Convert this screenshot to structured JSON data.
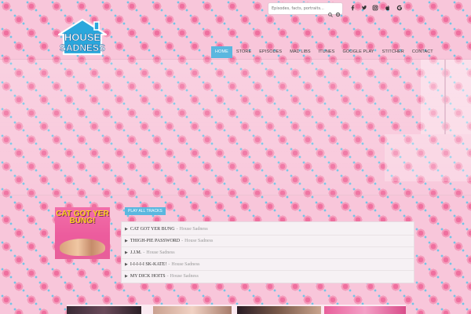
{
  "search": {
    "placeholder": "Episodes, facts, portraits..."
  },
  "social": [
    {
      "icon": "facebook-icon"
    },
    {
      "icon": "twitter-icon"
    },
    {
      "icon": "instagram-icon"
    },
    {
      "icon": "apple-icon"
    },
    {
      "icon": "google-icon"
    }
  ],
  "logo": {
    "line1": "HOUSE",
    "line2": "SADNESS"
  },
  "nav": [
    {
      "label": "HOME",
      "active": true
    },
    {
      "label": "STORE"
    },
    {
      "label": "EPISODES"
    },
    {
      "label": "MAD LIBS"
    },
    {
      "label": "ITUNES"
    },
    {
      "label": "GOOGLE PLAY"
    },
    {
      "label": "STITCHER"
    },
    {
      "label": "CONTACT"
    }
  ],
  "album": {
    "title": "CAT GOT YER BUNG!"
  },
  "player": {
    "play_all_label": "PLAY ALL TRACKS",
    "separator": "-",
    "tracks": [
      {
        "title": "CAT GOT YER BUNG",
        "artist": "House Sadness"
      },
      {
        "title": "THIGH-PIE PASSWORD",
        "artist": "House Sadness"
      },
      {
        "title": "J.J.M.",
        "artist": "House Sadness"
      },
      {
        "title": "I-I-I-I-I SK-KATE!",
        "artist": "House Sadness"
      },
      {
        "title": "MY DICK HOITS",
        "artist": "House Sadness"
      }
    ]
  },
  "colors": {
    "accent": "#5ab7df",
    "pattern_pink": "#f8c6da",
    "flower": "#ef6f9f"
  }
}
